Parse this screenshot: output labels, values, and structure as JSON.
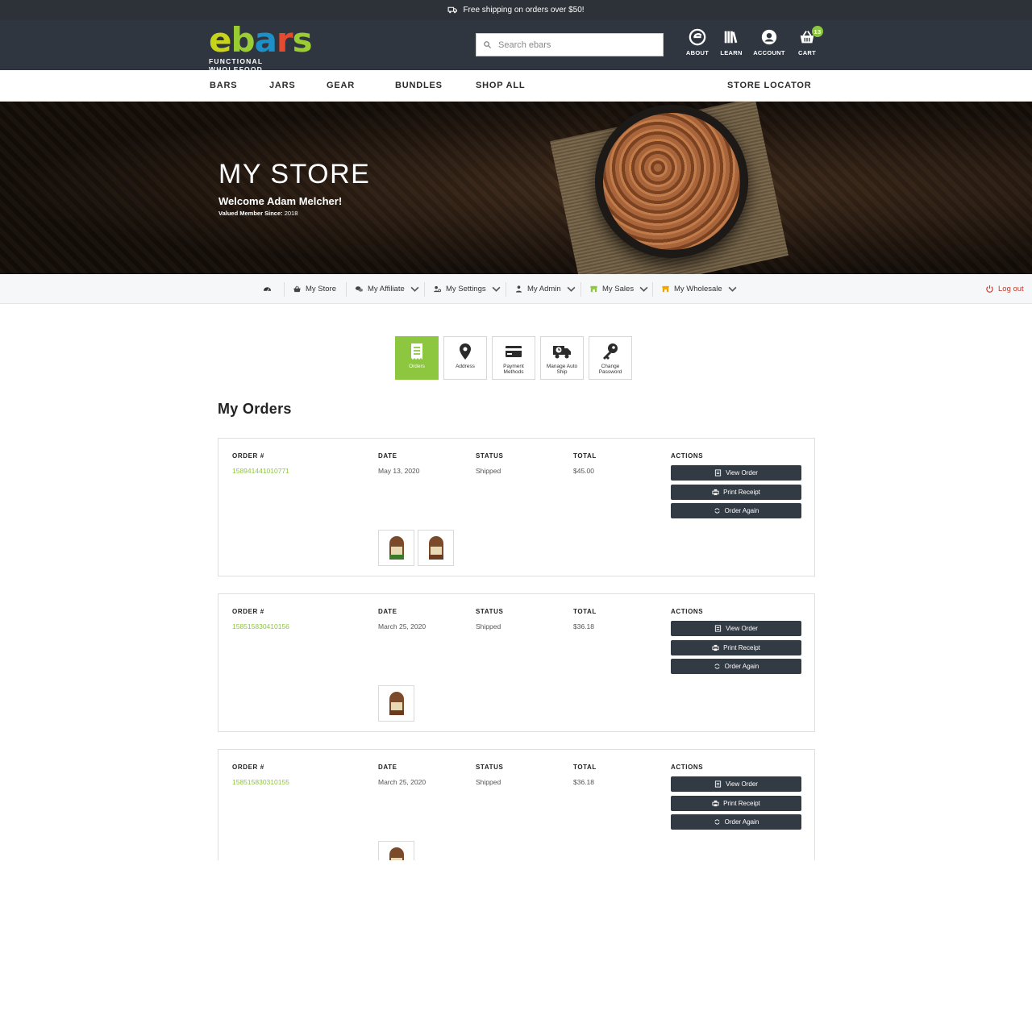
{
  "promo": {
    "text": "Free shipping on orders over $50!",
    "icon": "truck-icon"
  },
  "header": {
    "logo_text": "ebars",
    "logo_sub": "FUNCTIONAL WHOLEFOOD",
    "search_placeholder": "Search ebars",
    "links": [
      {
        "label": "ABOUT",
        "icon": "brand-e-icon"
      },
      {
        "label": "LEARN",
        "icon": "books-icon"
      },
      {
        "label": "ACCOUNT",
        "icon": "user-circle-icon"
      },
      {
        "label": "CART",
        "icon": "basket-icon",
        "badge": "13"
      }
    ]
  },
  "catnav": {
    "items": [
      "BARS",
      "JARS",
      "GEAR",
      "BUNDLES",
      "SHOP ALL"
    ],
    "store_locator": "STORE LOCATOR"
  },
  "hero": {
    "title": "MY STORE",
    "welcome": "Welcome Adam Melcher!",
    "since_label": "Valued Member Since:",
    "since_year": "2018"
  },
  "account_menu": {
    "items": [
      "My Store",
      "My Affiliate",
      "My Settings",
      "My Admin",
      "My Sales",
      "My Wholesale"
    ],
    "logout": "Log out"
  },
  "tiles": [
    {
      "label": "Orders",
      "icon": "receipt-icon",
      "active": true
    },
    {
      "label": "Address",
      "icon": "map-pin-icon"
    },
    {
      "label": "Payment Methods",
      "icon": "credit-card-icon"
    },
    {
      "label": "Manage Auto Ship",
      "icon": "truck-clock-icon"
    },
    {
      "label": "Change Password",
      "icon": "key-icon"
    }
  ],
  "orders_title": "My Orders",
  "order_headers": {
    "order": "ORDER #",
    "date": "DATE",
    "status": "STATUS",
    "total": "TOTAL",
    "actions": "ACTIONS"
  },
  "order_actions": {
    "view": "View Order",
    "print": "Print Receipt",
    "again": "Order Again"
  },
  "orders": [
    {
      "number": "158941441010771",
      "date": "May 13, 2020",
      "status": "Shipped",
      "total": "$45.00",
      "thumbs": 2
    },
    {
      "number": "158515830410156",
      "date": "March 25, 2020",
      "status": "Shipped",
      "total": "$36.18",
      "thumbs": 1
    },
    {
      "number": "158515830310155",
      "date": "March 25, 2020",
      "status": "Shipped",
      "total": "$36.18",
      "thumbs": 1
    }
  ],
  "colors": {
    "accent": "#8dc63f",
    "header_bg": "#2f3640",
    "button_bg": "#323a44",
    "logout": "#c0392b"
  }
}
